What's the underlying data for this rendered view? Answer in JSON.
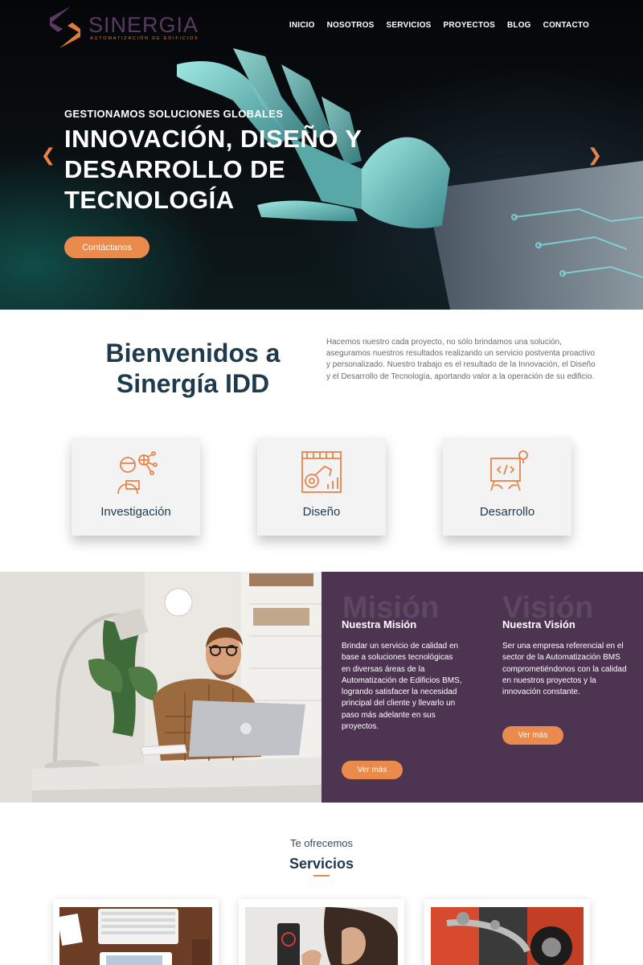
{
  "brand": {
    "name": "SINERGIA",
    "tagline": "AUTOMATIZACIÓN DE EDIFICIOS",
    "colors": {
      "accent": "#ea8a4c",
      "purple": "#4d3552",
      "navy": "#1f3a4d"
    }
  },
  "nav": {
    "items": [
      "INICIO",
      "NOSOTROS",
      "SERVICIOS",
      "PROYECTOS",
      "BLOG",
      "CONTACTO"
    ]
  },
  "hero": {
    "kicker": "GESTIONAMOS SOLUCIONES GLOBALES",
    "title": "INNOVACIÓN, DISEÑO Y DESARROLLO DE TECNOLOGÍA",
    "button": "Contáctanos",
    "prev_icon": "chevron-left-icon",
    "next_icon": "chevron-right-icon"
  },
  "welcome": {
    "title": "Bienvenidos a Sinergía IDD",
    "text": "Hacemos nuestro cada proyecto, no sólo brindamos una solución, aseguramos nuestros resultados realizando un servicio postventa proactivo y personalizado. Nuestro trabajo es el resultado de la Innovación, el Diseño y el Desarrollo de Tecnología, aportando valor a la operación de su edificio."
  },
  "features": [
    {
      "label": "Investigación",
      "icon": "research-icon"
    },
    {
      "label": "Diseño",
      "icon": "design-icon"
    },
    {
      "label": "Desarrollo",
      "icon": "development-icon"
    }
  ],
  "mission": {
    "ghost": "Misión",
    "title": "Nuestra Misión",
    "text": "Brindar un servicio de calidad en base a soluciones tecnológicas en diversas áreas de la Automatización de Edificios BMS, logrando satisfacer la necesidad principal del cliente y llevarlo un paso más adelante en sus proyectos.",
    "button": "Ver más"
  },
  "vision": {
    "ghost": "Visión",
    "title": "Nuestra Visión",
    "text": "Ser una empresa referencial en el sector de la Automatización BMS comprometiéndonos con la calidad en nuestros proyectos y la innovación constante.",
    "button": "Ver más"
  },
  "services": {
    "kicker": "Te ofrecemos",
    "title": "Servicios"
  }
}
